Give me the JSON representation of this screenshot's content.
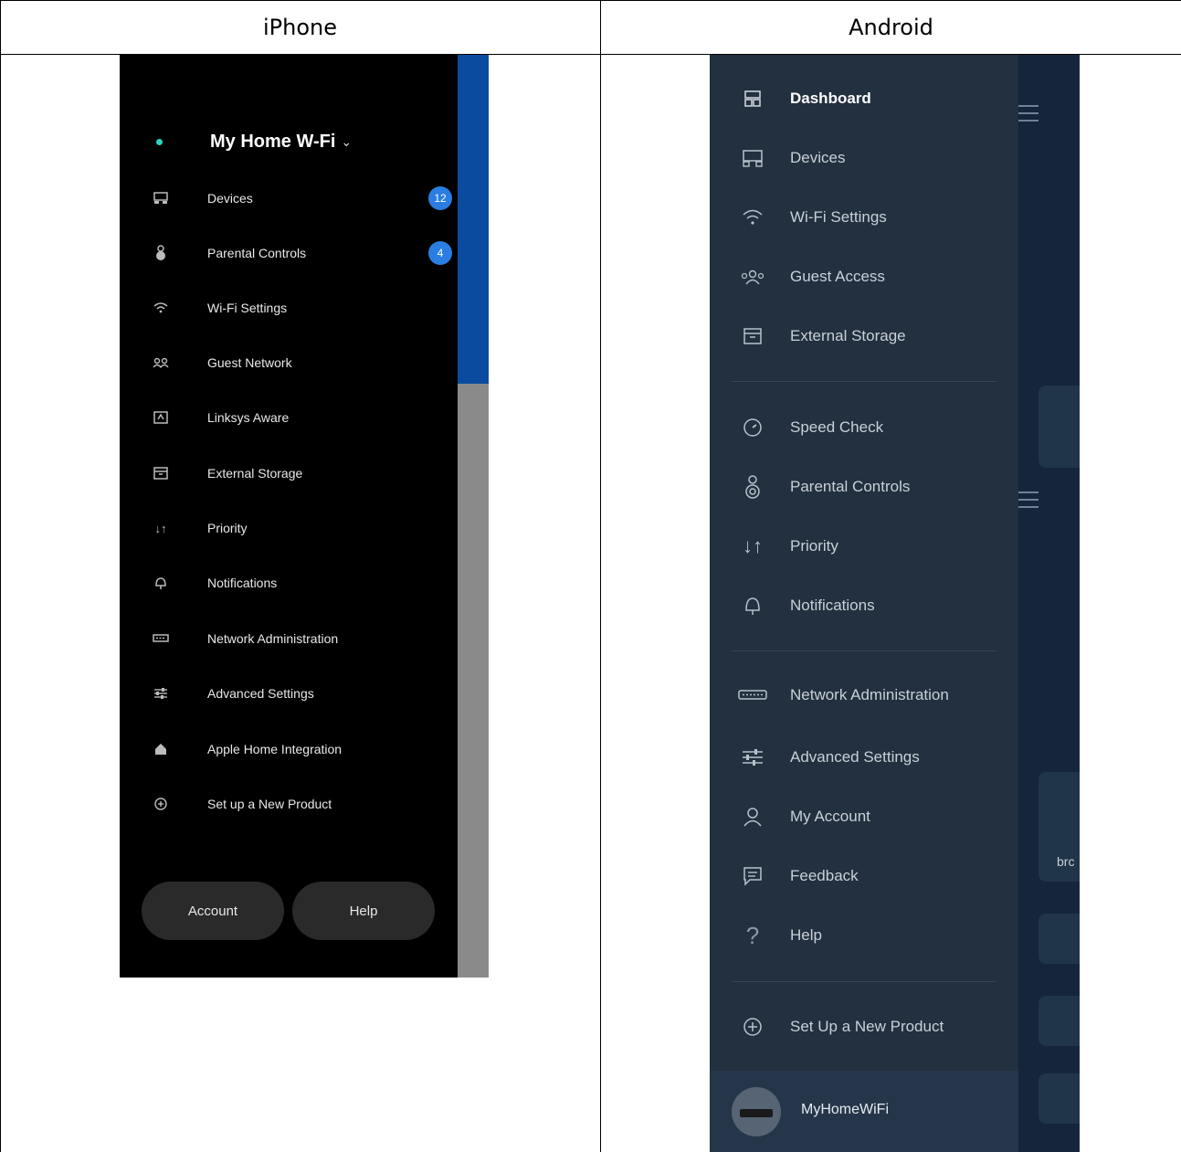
{
  "table": {
    "col_headers": [
      "iPhone",
      "Android"
    ]
  },
  "iphone": {
    "network_name": "My Home W-Fi",
    "network_chevron": "⌄",
    "items": [
      {
        "label": "Devices",
        "icon": "devices-icon",
        "badge": "12"
      },
      {
        "label": "Parental Controls",
        "icon": "parental-controls-icon",
        "badge": "4"
      },
      {
        "label": "Wi-Fi Settings",
        "icon": "wifi-icon"
      },
      {
        "label": "Guest Network",
        "icon": "guest-network-icon"
      },
      {
        "label": "Linksys Aware",
        "icon": "linksys-aware-icon"
      },
      {
        "label": "External Storage",
        "icon": "external-storage-icon"
      },
      {
        "label": "Priority",
        "icon": "priority-icon"
      },
      {
        "label": "Notifications",
        "icon": "notifications-icon"
      },
      {
        "label": "Network Administration",
        "icon": "network-admin-icon"
      },
      {
        "label": "Advanced Settings",
        "icon": "advanced-settings-icon"
      },
      {
        "label": "Apple Home Integration",
        "icon": "apple-home-icon"
      },
      {
        "label": "Set up a New Product",
        "icon": "add-product-icon"
      }
    ],
    "buttons": {
      "account": "Account",
      "help": "Help"
    }
  },
  "android": {
    "items": [
      {
        "label": "Dashboard",
        "icon": "dashboard-icon"
      },
      {
        "label": "Devices",
        "icon": "devices-icon"
      },
      {
        "label": "Wi-Fi Settings",
        "icon": "wifi-icon"
      },
      {
        "label": "Guest Access",
        "icon": "guest-access-icon"
      },
      {
        "label": "External Storage",
        "icon": "external-storage-icon"
      },
      {
        "label": "Speed Check",
        "icon": "speed-check-icon"
      },
      {
        "label": "Parental Controls",
        "icon": "parental-controls-icon"
      },
      {
        "label": "Priority",
        "icon": "priority-icon"
      },
      {
        "label": "Notifications",
        "icon": "notifications-icon"
      },
      {
        "label": "Network Administration",
        "icon": "network-admin-icon"
      },
      {
        "label": "Advanced Settings",
        "icon": "advanced-settings-icon"
      },
      {
        "label": "My Account",
        "icon": "account-icon"
      },
      {
        "label": "Feedback",
        "icon": "feedback-icon"
      },
      {
        "label": "Help",
        "icon": "help-icon"
      },
      {
        "label": "Set Up a New Product",
        "icon": "add-product-icon"
      }
    ],
    "network_name": "MyHomeWiFi",
    "background_fragment": "brc"
  },
  "colors": {
    "iphone_bg": "#000000",
    "iphone_badge": "#2a7de1",
    "iphone_accent_strip": "#0a4ba0",
    "android_drawer": "#22303f",
    "status_dot": "#2ed3c2"
  }
}
